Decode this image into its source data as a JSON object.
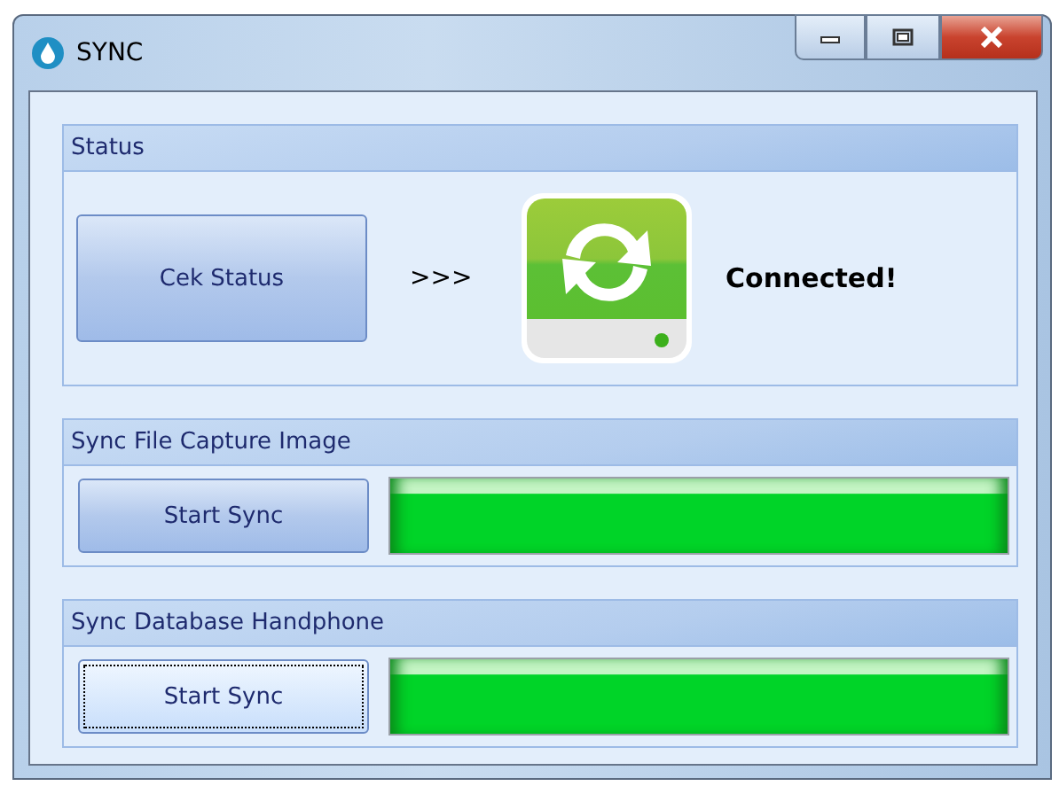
{
  "window": {
    "title": "SYNC"
  },
  "status": {
    "title": "Status",
    "button": "Cek Status",
    "arrow": ">>>",
    "message": "Connected!"
  },
  "sync_groups": [
    {
      "title": "Sync File Capture Image",
      "button": "Start Sync",
      "focused": false,
      "level": 1
    },
    {
      "title": "Sync Database Handphone",
      "button": "Start Sync",
      "focused": true,
      "level": 1
    }
  ]
}
